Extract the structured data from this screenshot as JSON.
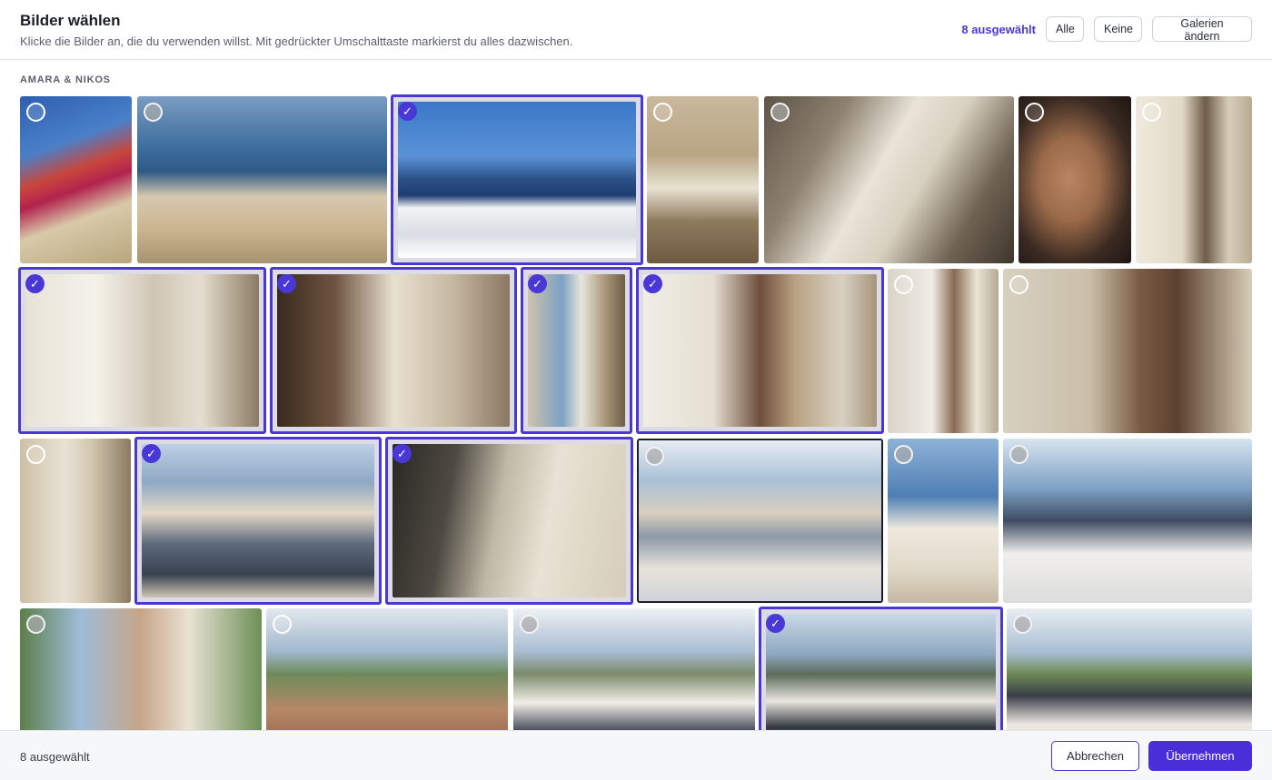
{
  "header": {
    "title": "Bilder wählen",
    "subtitle": "Klicke die Bilder an, die du verwenden willst. Mit gedrückter Umschalttaste markierst du alles dazwischen.",
    "selected_count": "8 ausgewählt",
    "btn_all": "Alle",
    "btn_none": "Keine",
    "btn_galleries": "Galerien ändern"
  },
  "section": {
    "label": "AMARA & NIKOS"
  },
  "colors": {
    "accent": "#4a38d6",
    "accent_button": "#4a2fd8"
  },
  "photos": [
    {
      "name": "photo-bougainvillea",
      "selected": false,
      "icon": "unchecked-circle-icon"
    },
    {
      "name": "photo-invitation-card",
      "selected": false,
      "icon": "unchecked-circle-icon"
    },
    {
      "name": "photo-santorini-view",
      "selected": true,
      "icon": "check-icon"
    },
    {
      "name": "photo-dress-hanging",
      "selected": false,
      "icon": "unchecked-circle-icon"
    },
    {
      "name": "photo-shoes-window",
      "selected": false,
      "icon": "unchecked-circle-icon"
    },
    {
      "name": "photo-bride-makeup",
      "selected": false,
      "icon": "unchecked-circle-icon"
    },
    {
      "name": "photo-hair-styling",
      "selected": false,
      "icon": "unchecked-circle-icon"
    },
    {
      "name": "photo-veil-room",
      "selected": true,
      "icon": "check-icon"
    },
    {
      "name": "photo-earring",
      "selected": true,
      "icon": "check-icon"
    },
    {
      "name": "photo-bride-window",
      "selected": true,
      "icon": "check-icon"
    },
    {
      "name": "photo-bride-mother",
      "selected": true,
      "icon": "check-icon"
    },
    {
      "name": "photo-groom-buttoning",
      "selected": false,
      "icon": "unchecked-circle-icon"
    },
    {
      "name": "photo-groom-watch",
      "selected": false,
      "icon": "unchecked-circle-icon"
    },
    {
      "name": "photo-bride-arch",
      "selected": false,
      "icon": "unchecked-circle-icon"
    },
    {
      "name": "photo-groom-guests",
      "selected": true,
      "icon": "check-icon"
    },
    {
      "name": "photo-boutonniere",
      "selected": true,
      "icon": "check-icon"
    },
    {
      "name": "photo-guests-seated",
      "selected": false,
      "icon": "unchecked-circle-icon"
    },
    {
      "name": "photo-groom-portrait",
      "selected": false,
      "icon": "unchecked-circle-icon"
    },
    {
      "name": "photo-walk-aisle",
      "selected": false,
      "icon": "unchecked-circle-icon"
    },
    {
      "name": "photo-groom-arch",
      "selected": false,
      "icon": "unchecked-circle-icon"
    },
    {
      "name": "photo-ring-exchange",
      "selected": false,
      "icon": "unchecked-circle-icon"
    },
    {
      "name": "photo-couple-altar",
      "selected": false,
      "icon": "unchecked-circle-icon"
    },
    {
      "name": "photo-confetti-exit",
      "selected": true,
      "icon": "check-icon"
    },
    {
      "name": "photo-kiss",
      "selected": false,
      "icon": "unchecked-circle-icon"
    }
  ],
  "footer": {
    "selected_count": "8 ausgewählt",
    "btn_cancel": "Abbrechen",
    "btn_apply": "Übernehmen"
  }
}
